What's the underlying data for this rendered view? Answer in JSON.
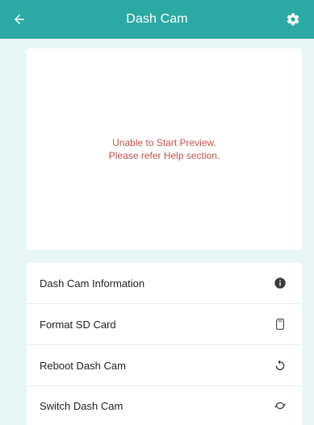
{
  "app_bar": {
    "title": "Dash Cam",
    "back_icon": "arrow-left-icon",
    "settings_icon": "gear-icon",
    "background_color": "#2ba9a2"
  },
  "preview": {
    "message_line1": "Unable to Start Preview.",
    "message_line2": "Please refer Help section.",
    "message_color": "#c0504d"
  },
  "menu": {
    "items": [
      {
        "label": "Dash Cam Information",
        "icon": "info-icon"
      },
      {
        "label": "Format SD Card",
        "icon": "sd-card-icon"
      },
      {
        "label": "Reboot Dash Cam",
        "icon": "reboot-icon"
      },
      {
        "label": "Switch Dash Cam",
        "icon": "switch-icon"
      }
    ]
  }
}
